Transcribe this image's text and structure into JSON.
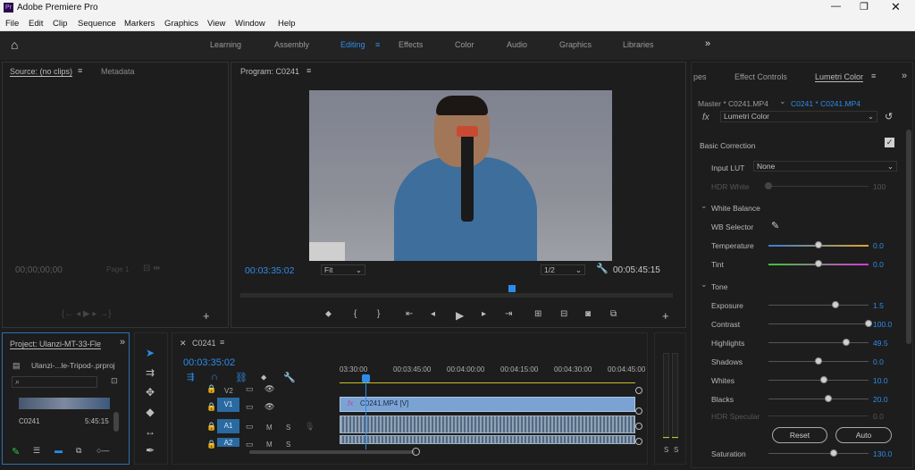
{
  "app": {
    "title": "Adobe Premiere Pro"
  },
  "menu": [
    "File",
    "Edit",
    "Clip",
    "Sequence",
    "Markers",
    "Graphics",
    "View",
    "Window",
    "Help"
  ],
  "workspaces": {
    "learning": "Learning",
    "assembly": "Assembly",
    "editing": "Editing",
    "effects": "Effects",
    "color": "Color",
    "audio": "Audio",
    "graphics": "Graphics",
    "libraries": "Libraries"
  },
  "source": {
    "tab": "Source: (no clips)",
    "metadata": "Metadata",
    "timecode": "00;00;00;00",
    "page": "Page 1"
  },
  "program": {
    "tab": "Program: C0241",
    "timecode": "00:03:35:02",
    "fit": "Fit",
    "resolution": "1/2",
    "duration": "00:05:45:15"
  },
  "right_tabs": {
    "partial": "pes",
    "effect_controls": "Effect Controls",
    "lumetri": "Lumetri Color"
  },
  "lumetri": {
    "master": "Master * C0241.MP4",
    "clip": "C0241 * C0241.MP4",
    "fx": "fx",
    "effect": "Lumetri Color",
    "basic": "Basic Correction",
    "input_lut_label": "Input LUT",
    "input_lut_value": "None",
    "hdr_white": "HDR White",
    "hdr_white_val": "100",
    "white_balance": "White Balance",
    "wb_selector": "WB Selector",
    "tone": "Tone",
    "reset": "Reset",
    "auto": "Auto",
    "hdr_specular": "HDR Specular",
    "hdr_specular_val": "0.0",
    "wb": [
      {
        "label": "Temperature",
        "value": "0.0",
        "level": 0.5
      },
      {
        "label": "Tint",
        "value": "0.0",
        "level": 0.5
      }
    ],
    "tone_sliders": [
      {
        "label": "Exposure",
        "value": "1.5",
        "level": 0.67
      },
      {
        "label": "Contrast",
        "value": "100.0",
        "level": 1.0
      },
      {
        "label": "Highlights",
        "value": "49.5",
        "level": 0.78
      },
      {
        "label": "Shadows",
        "value": "0.0",
        "level": 0.5
      },
      {
        "label": "Whites",
        "value": "10.0",
        "level": 0.55
      },
      {
        "label": "Blacks",
        "value": "20.0",
        "level": 0.6
      }
    ],
    "saturation_label": "Saturation",
    "saturation_value": "130.0",
    "saturation_level": 0.65
  },
  "project": {
    "tab": "Project: Ulanzi-MT-33-Fle",
    "file": "Ulanzi-...le-Tripod-.prproj",
    "clip_name": "C0241",
    "clip_duration": "5:45:15"
  },
  "timeline": {
    "tab": "C0241",
    "timecode": "00:03:35:02",
    "ruler": [
      "03:30:00",
      "00:03:45:00",
      "00:04:00:00",
      "00:04:15:00",
      "00:04:30:00",
      "00:04:45:00"
    ],
    "v2": "V2",
    "v1": "V1",
    "a1": "A1",
    "a2": "A2",
    "clip_label": "C0241.MP4 [V]",
    "fx_badge": "fx",
    "m": "M",
    "s": "S"
  },
  "meter": {
    "s1": "S",
    "s2": "S"
  }
}
